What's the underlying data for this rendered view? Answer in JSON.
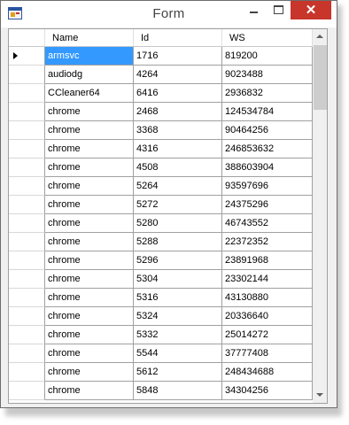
{
  "window": {
    "title": "Form",
    "close_glyph": "✕",
    "icons": [
      "app-icon",
      "minimize-icon",
      "maximize-icon",
      "close-icon"
    ]
  },
  "grid": {
    "columns": [
      "Name",
      "Id",
      "WS"
    ],
    "selected_row": 0,
    "rows": [
      {
        "name": "armsvc",
        "id": "1716",
        "ws": "819200"
      },
      {
        "name": "audiodg",
        "id": "4264",
        "ws": "9023488"
      },
      {
        "name": "CCleaner64",
        "id": "6416",
        "ws": "2936832"
      },
      {
        "name": "chrome",
        "id": "2468",
        "ws": "124534784"
      },
      {
        "name": "chrome",
        "id": "3368",
        "ws": "90464256"
      },
      {
        "name": "chrome",
        "id": "4316",
        "ws": "246853632"
      },
      {
        "name": "chrome",
        "id": "4508",
        "ws": "388603904"
      },
      {
        "name": "chrome",
        "id": "5264",
        "ws": "93597696"
      },
      {
        "name": "chrome",
        "id": "5272",
        "ws": "24375296"
      },
      {
        "name": "chrome",
        "id": "5280",
        "ws": "46743552"
      },
      {
        "name": "chrome",
        "id": "5288",
        "ws": "22372352"
      },
      {
        "name": "chrome",
        "id": "5296",
        "ws": "23891968"
      },
      {
        "name": "chrome",
        "id": "5304",
        "ws": "23302144"
      },
      {
        "name": "chrome",
        "id": "5316",
        "ws": "43130880"
      },
      {
        "name": "chrome",
        "id": "5324",
        "ws": "20336640"
      },
      {
        "name": "chrome",
        "id": "5332",
        "ws": "25014272"
      },
      {
        "name": "chrome",
        "id": "5544",
        "ws": "37777408"
      },
      {
        "name": "chrome",
        "id": "5612",
        "ws": "248434688"
      },
      {
        "name": "chrome",
        "id": "5848",
        "ws": "34304256"
      }
    ]
  },
  "colors": {
    "selection": "#3399ff",
    "close_button": "#c7352b"
  }
}
